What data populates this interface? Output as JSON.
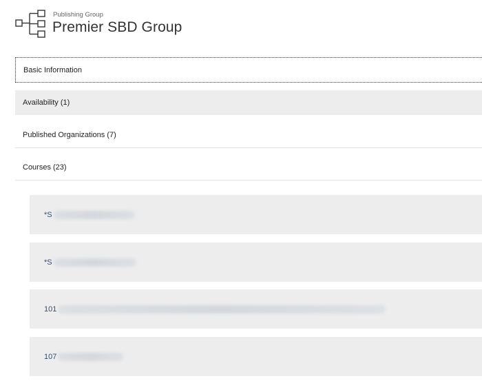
{
  "header": {
    "subtitle": "Publishing Group",
    "title": "Premier SBD Group",
    "icon": "org-chart-icon"
  },
  "sections": {
    "basic": "Basic Information",
    "availability": "Availability (1)",
    "published_orgs": "Published Organizations (7)",
    "courses": "Courses (23)"
  },
  "courses": [
    {
      "code": "*S"
    },
    {
      "code": "*S"
    },
    {
      "code": "101"
    },
    {
      "code": "107"
    }
  ],
  "colors": {
    "section_bg": "#ededed",
    "course_text": "#2a4f7a"
  }
}
